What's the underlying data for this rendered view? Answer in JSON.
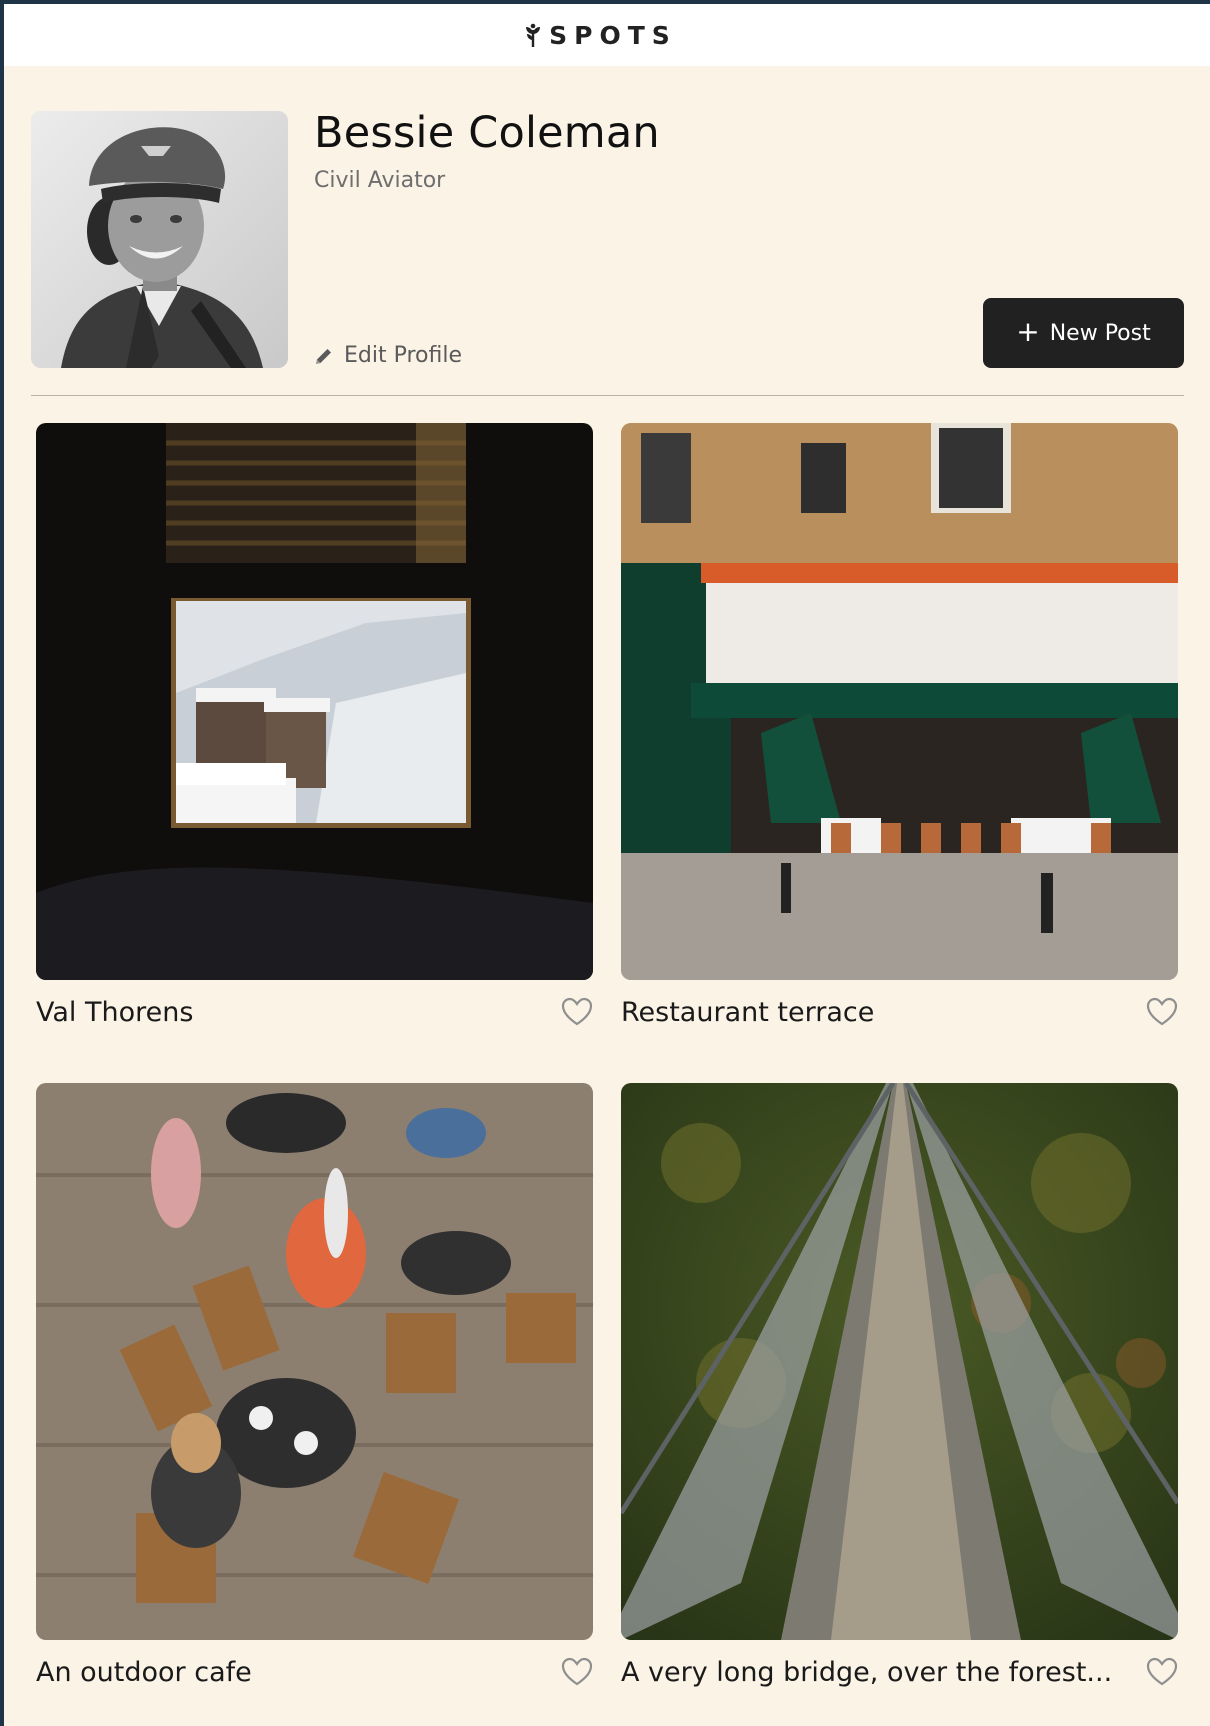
{
  "header": {
    "logo_text": "SPOTS",
    "logo_icon": "sprout-icon"
  },
  "profile": {
    "name": "Bessie Coleman",
    "role": "Civil Aviator",
    "edit_label": "Edit Profile",
    "edit_icon": "pencil-icon",
    "new_post_label": "New Post",
    "new_post_icon": "plus-icon"
  },
  "cards": [
    {
      "title": "Val Thorens",
      "like_icon": "heart-outline-icon"
    },
    {
      "title": "Restaurant terrace",
      "like_icon": "heart-outline-icon"
    },
    {
      "title": "An outdoor cafe",
      "like_icon": "heart-outline-icon"
    },
    {
      "title": "A very long bridge, over the forest...",
      "like_icon": "heart-outline-icon"
    }
  ],
  "colors": {
    "page_background": "#faf3e6",
    "button_dark": "#212121",
    "text_muted": "#6e6e6e"
  }
}
